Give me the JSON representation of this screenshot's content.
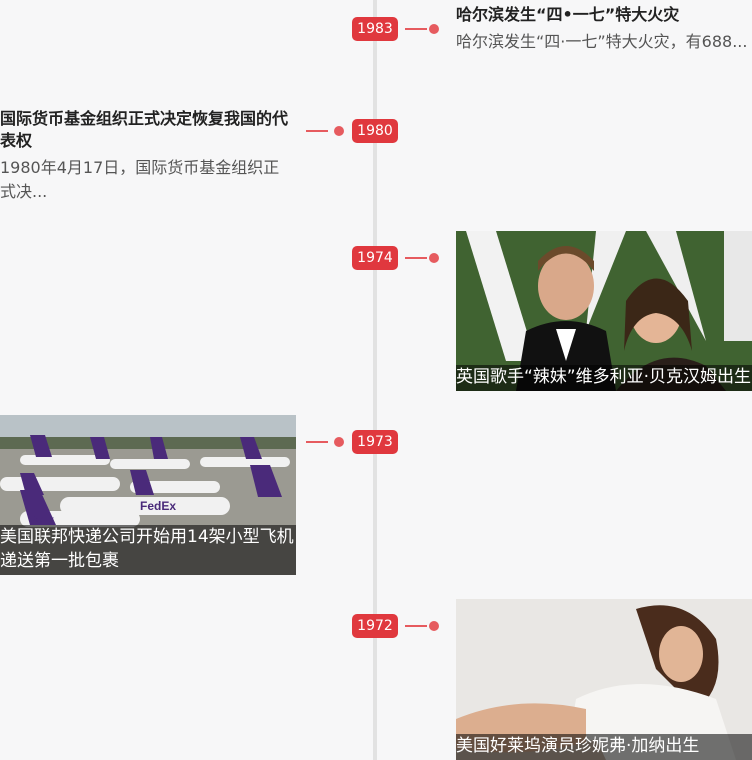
{
  "events": [
    {
      "year": "1983",
      "title": "哈尔滨发生“四•一七”特大火灾",
      "summary": "哈尔滨发生“四·一七”特大火灾，有688..."
    },
    {
      "year": "1980",
      "title": "国际货币基金组织正式决定恢复我国的代表权",
      "summary": "1980年4月17日，国际货币基金组织正式决..."
    },
    {
      "year": "1974",
      "caption": "英国歌手“辣妹”维多利亚·贝克汉姆出生"
    },
    {
      "year": "1973",
      "caption": "美国联邦快递公司开始用14架小型飞机递送第一批包裹"
    },
    {
      "year": "1972",
      "caption": "美国好莱坞演员珍妮弗·加纳出生"
    }
  ],
  "colors": {
    "accent": "#e0383e",
    "axis": "#e2e2e2",
    "background": "#f7f7f8"
  }
}
